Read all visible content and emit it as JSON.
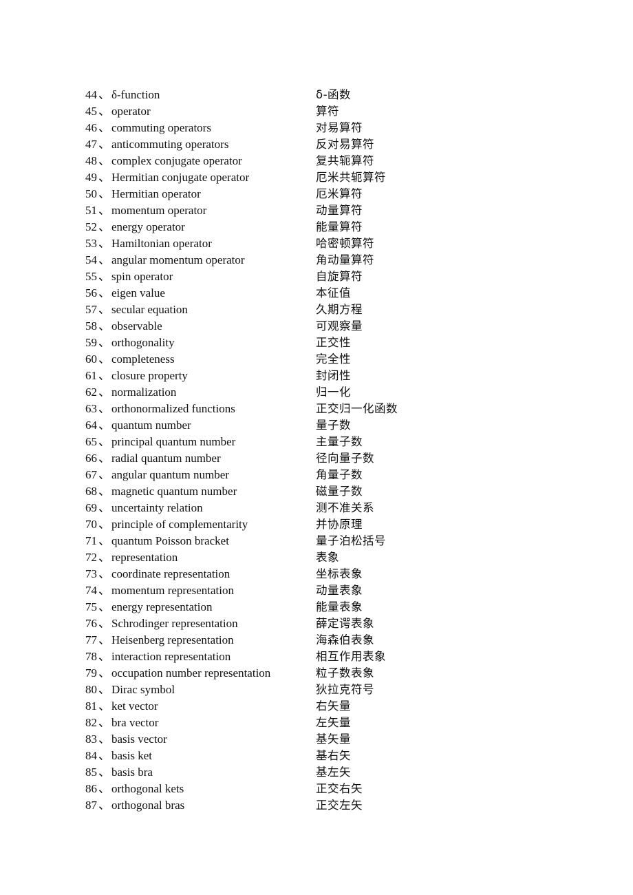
{
  "document": {
    "separator": "、",
    "entries": [
      {
        "num": "44",
        "en": "δ-function",
        "zh": "δ-函数"
      },
      {
        "num": "45",
        "en": "operator",
        "zh": "算符"
      },
      {
        "num": "46",
        "en": "commuting operators",
        "zh": "对易算符"
      },
      {
        "num": "47",
        "en": "anticommuting operators",
        "zh": "反对易算符"
      },
      {
        "num": "48",
        "en": "complex conjugate operator",
        "zh": "复共轭算符"
      },
      {
        "num": "49",
        "en": "Hermitian conjugate operator",
        "zh": "厄米共轭算符"
      },
      {
        "num": "50",
        "en": "Hermitian operator",
        "zh": "厄米算符"
      },
      {
        "num": "51",
        "en": "momentum operator",
        "zh": "动量算符"
      },
      {
        "num": "52",
        "en": "energy operator",
        "zh": "能量算符"
      },
      {
        "num": "53",
        "en": "Hamiltonian operator",
        "zh": "哈密顿算符"
      },
      {
        "num": "54",
        "en": "angular momentum operator",
        "zh": "角动量算符"
      },
      {
        "num": "55",
        "en": "spin operator",
        "zh": "自旋算符"
      },
      {
        "num": "56",
        "en": "eigen value",
        "zh": "本征值"
      },
      {
        "num": "57",
        "en": "secular equation",
        "zh": "久期方程"
      },
      {
        "num": "58",
        "en": "observable",
        "zh": "可观察量"
      },
      {
        "num": "59",
        "en": "orthogonality",
        "zh": "正交性"
      },
      {
        "num": "60",
        "en": "completeness",
        "zh": "完全性"
      },
      {
        "num": "61",
        "en": "closure property",
        "zh": "封闭性"
      },
      {
        "num": "62",
        "en": "normalization",
        "zh": "归一化"
      },
      {
        "num": "63",
        "en": "orthonormalized functions",
        "zh": "正交归一化函数"
      },
      {
        "num": "64",
        "en": "quantum number",
        "zh": "量子数"
      },
      {
        "num": "65",
        "en": "principal quantum number",
        "zh": "主量子数"
      },
      {
        "num": "66",
        "en": "radial quantum number",
        "zh": "径向量子数"
      },
      {
        "num": "67",
        "en": "angular quantum number",
        "zh": "角量子数"
      },
      {
        "num": "68",
        "en": "magnetic quantum number",
        "zh": "磁量子数"
      },
      {
        "num": "69",
        "en": "uncertainty relation",
        "zh": "测不准关系"
      },
      {
        "num": "70",
        "en": "principle of complementarity",
        "zh": "并协原理"
      },
      {
        "num": "71",
        "en": "quantum Poisson bracket",
        "zh": "量子泊松括号"
      },
      {
        "num": "72",
        "en": "representation",
        "zh": "表象"
      },
      {
        "num": "73",
        "en": "coordinate representation",
        "zh": "坐标表象"
      },
      {
        "num": "74",
        "en": "momentum representation",
        "zh": "动量表象"
      },
      {
        "num": "75",
        "en": "energy representation",
        "zh": "能量表象"
      },
      {
        "num": "76",
        "en": "Schrodinger representation",
        "zh": "薛定谔表象"
      },
      {
        "num": "77",
        "en": "Heisenberg representation",
        "zh": "海森伯表象"
      },
      {
        "num": "78",
        "en": "interaction representation",
        "zh": "相互作用表象"
      },
      {
        "num": "79",
        "en": "occupation number representation",
        "zh": "粒子数表象"
      },
      {
        "num": "80",
        "en": "Dirac symbol",
        "zh": "狄拉克符号"
      },
      {
        "num": "81",
        "en": "ket vector",
        "zh": "右矢量"
      },
      {
        "num": "82",
        "en": "bra vector",
        "zh": "左矢量"
      },
      {
        "num": "83",
        "en": "basis vector",
        "zh": "基矢量"
      },
      {
        "num": "84",
        "en": "basis ket",
        "zh": "基右矢"
      },
      {
        "num": "85",
        "en": "basis bra",
        "zh": "基左矢"
      },
      {
        "num": "86",
        "en": "orthogonal kets",
        "zh": "正交右矢"
      },
      {
        "num": "87",
        "en": "orthogonal bras",
        "zh": "正交左矢"
      }
    ]
  }
}
